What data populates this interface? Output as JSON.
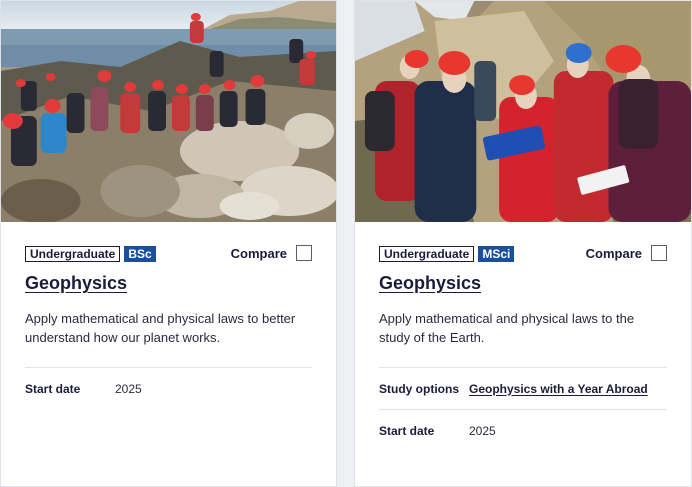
{
  "cards": [
    {
      "level": "Undergraduate",
      "degree": "BSc",
      "compare_label": "Compare",
      "title": "Geophysics",
      "description": "Apply mathematical and physical laws to better understand how our planet works.",
      "start_date_label": "Start date",
      "start_date": "2025"
    },
    {
      "level": "Undergraduate",
      "degree": "MSci",
      "compare_label": "Compare",
      "title": "Geophysics",
      "description": "Apply mathematical and physical laws to the study of the Earth.",
      "study_options_label": "Study options",
      "study_options_link": "Geophysics with a Year Abroad",
      "start_date_label": "Start date",
      "start_date": "2025"
    }
  ],
  "colors": {
    "degree_badge": "#1a4f9c",
    "helmet_red": "#e23a3a",
    "text": "#1b1b3a"
  }
}
